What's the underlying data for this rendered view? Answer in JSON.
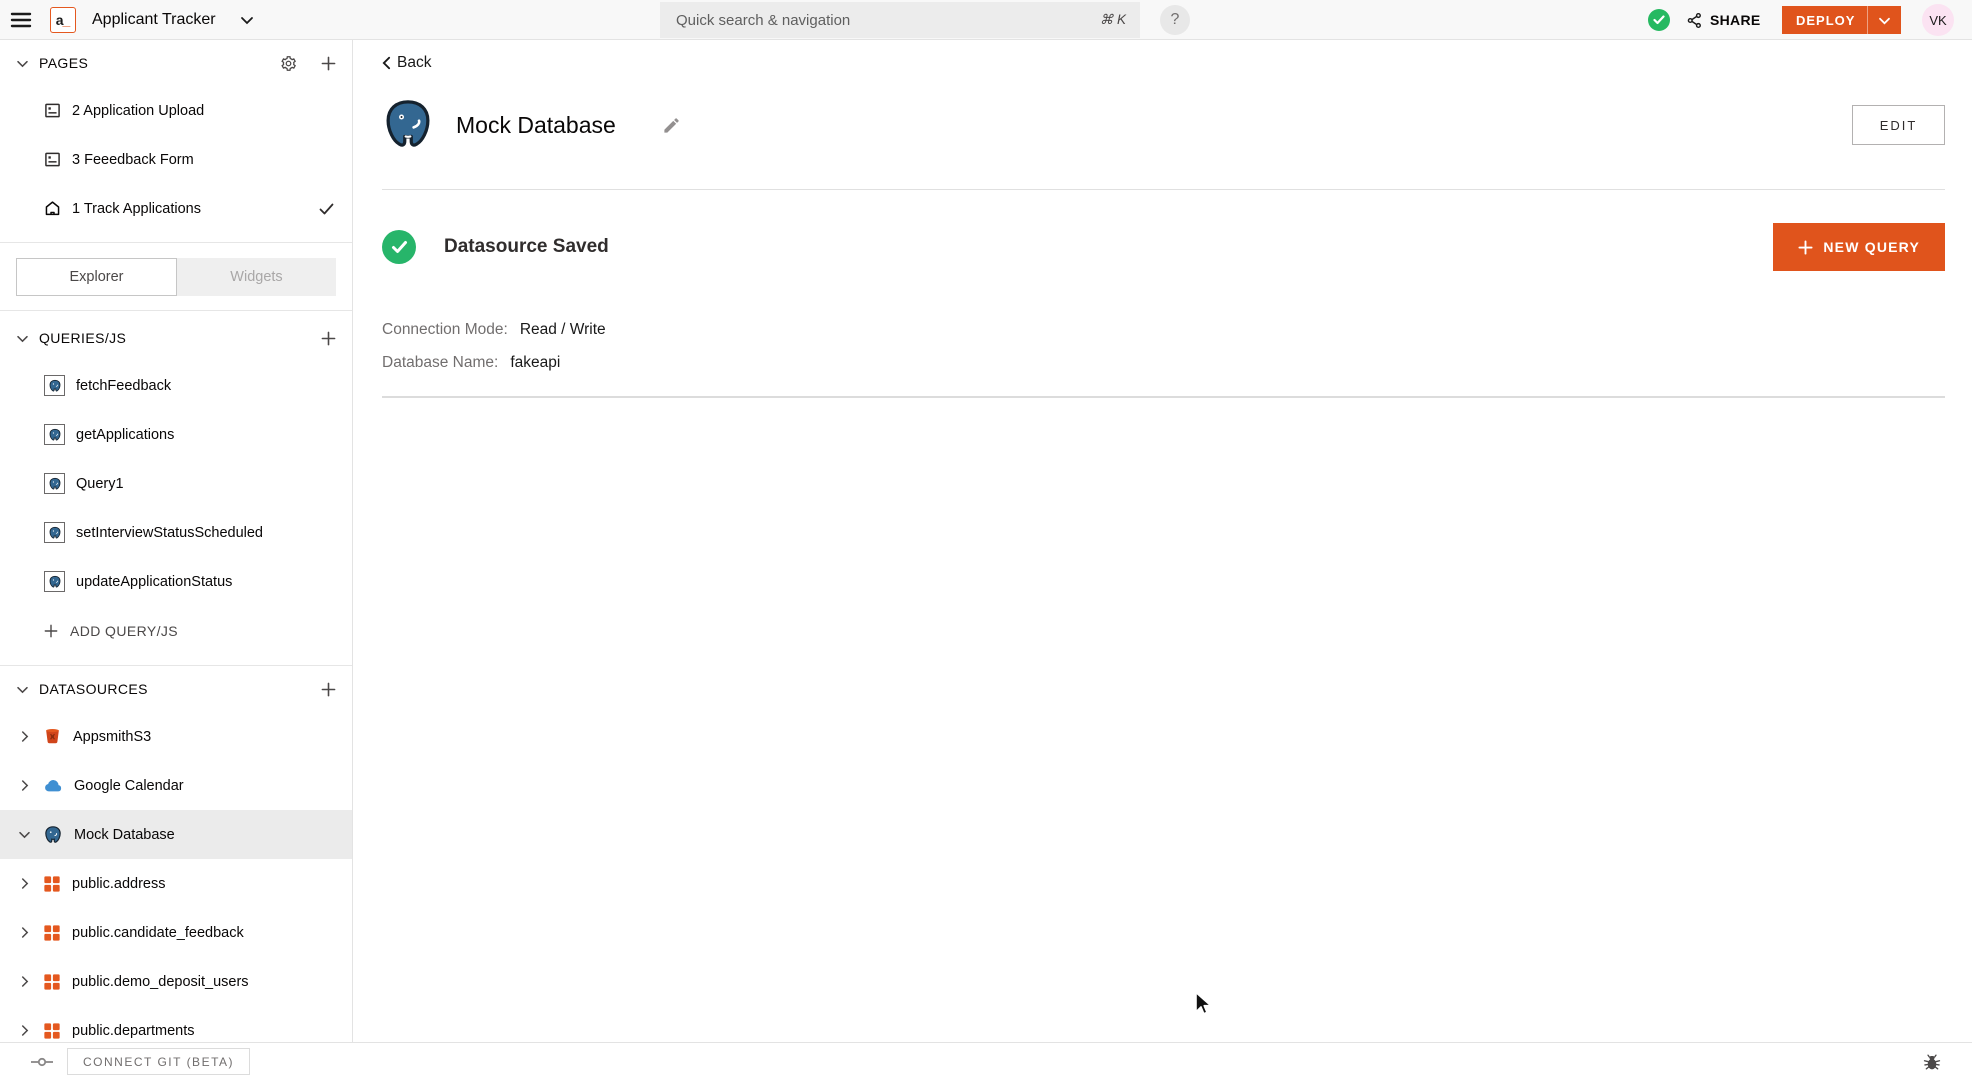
{
  "topbar": {
    "logo_a": "a",
    "logo_underscore": "_",
    "app_name": "Applicant Tracker",
    "search_placeholder": "Quick search & navigation",
    "search_shortcut": "⌘ K",
    "help_label": "?",
    "share_label": "SHARE",
    "deploy_label": "DEPLOY",
    "avatar_initials": "VK"
  },
  "sidebar": {
    "pages": {
      "title": "PAGES",
      "items": [
        {
          "label": "2 Application Upload"
        },
        {
          "label": "3 Feeedback Form"
        },
        {
          "label": "1 Track Applications",
          "checked": true
        }
      ]
    },
    "tabs": {
      "explorer": "Explorer",
      "widgets": "Widgets"
    },
    "queries": {
      "title": "QUERIES/JS",
      "items": [
        "fetchFeedback",
        "getApplications",
        "Query1",
        "setInterviewStatusScheduled",
        "updateApplicationStatus"
      ],
      "add_label": "ADD QUERY/JS"
    },
    "datasources": {
      "title": "DATASOURCES",
      "items": [
        {
          "label": "AppsmithS3"
        },
        {
          "label": "Google Calendar"
        },
        {
          "label": "Mock Database",
          "selected": true,
          "expanded": true
        }
      ],
      "tables": [
        "public.address",
        "public.candidate_feedback",
        "public.demo_deposit_users",
        "public.departments"
      ]
    },
    "footer_git_label": "CONNECT GIT (BETA)"
  },
  "main": {
    "back_label": "Back",
    "title": "Mock Database",
    "edit_button": "EDIT",
    "status_text": "Datasource Saved",
    "new_query_label": "NEW QUERY",
    "fields": [
      {
        "label": "Connection Mode:",
        "value": "Read / Write"
      },
      {
        "label": "Database Name:",
        "value": "fakeapi"
      }
    ]
  },
  "icons": {
    "hamburger-icon": "three horizontal lines",
    "chevron-down-icon": "v chevron",
    "chevron-right-icon": "> chevron",
    "gear-icon": "settings gear",
    "plus-icon": "+",
    "check-icon": "✓",
    "share-icon": "share nodes",
    "postgres-icon": "PostgreSQL elephant",
    "s3-icon": "S3 bucket",
    "cloud-icon": "cloud",
    "table-icon": "orange 2x2 grid",
    "home-icon": "house",
    "page-icon": "widget page",
    "pencil-icon": "edit pencil",
    "git-branch-icon": "-o-",
    "bug-icon": "debug bug"
  },
  "colors": {
    "accent_orange": "#e0541c",
    "icon_orange": "#e4581f",
    "success_green": "#27b56a",
    "topbar_green": "#26b961",
    "postgres_blue": "#336791",
    "avatar_pink": "#fbe3f2",
    "topbar_bg": "#f8f8f8",
    "selected_row": "#ebebeb",
    "border": "#e3e3e3"
  }
}
